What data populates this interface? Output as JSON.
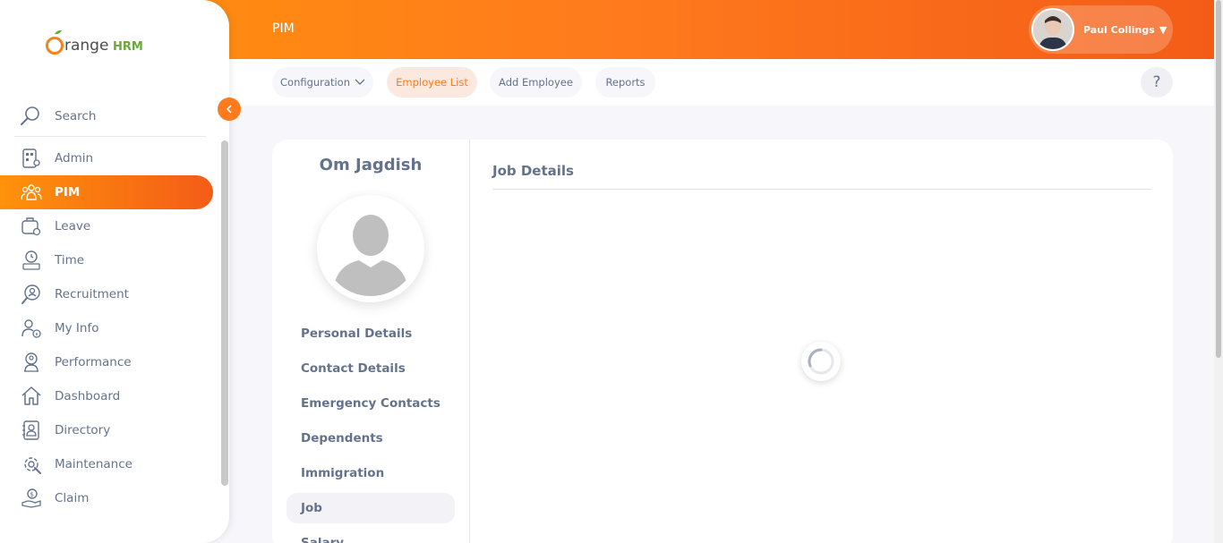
{
  "header": {
    "module_title": "PIM",
    "user_name": "Paul Collings"
  },
  "subnav": {
    "items": [
      {
        "label": "Configuration"
      },
      {
        "label": "Employee List"
      },
      {
        "label": "Add Employee"
      },
      {
        "label": "Reports"
      }
    ],
    "help": "?"
  },
  "sidebar": {
    "logo_text": "OrangeHRM",
    "search_label": "Search",
    "items": [
      {
        "label": "Admin",
        "icon": "admin-icon"
      },
      {
        "label": "PIM",
        "icon": "pim-icon"
      },
      {
        "label": "Leave",
        "icon": "leave-icon"
      },
      {
        "label": "Time",
        "icon": "time-icon"
      },
      {
        "label": "Recruitment",
        "icon": "recruitment-icon"
      },
      {
        "label": "My Info",
        "icon": "my-info-icon"
      },
      {
        "label": "Performance",
        "icon": "performance-icon"
      },
      {
        "label": "Dashboard",
        "icon": "dashboard-icon"
      },
      {
        "label": "Directory",
        "icon": "directory-icon"
      },
      {
        "label": "Maintenance",
        "icon": "maintenance-icon"
      },
      {
        "label": "Claim",
        "icon": "claim-icon"
      }
    ]
  },
  "employee": {
    "name": "Om Jagdish",
    "tabs": [
      {
        "label": "Personal Details"
      },
      {
        "label": "Contact Details"
      },
      {
        "label": "Emergency Contacts"
      },
      {
        "label": "Dependents"
      },
      {
        "label": "Immigration"
      },
      {
        "label": "Job"
      },
      {
        "label": "Salary"
      }
    ]
  },
  "section": {
    "title": "Job Details"
  },
  "colors": {
    "accent": "#ff7b1d",
    "text": "#64728c"
  }
}
